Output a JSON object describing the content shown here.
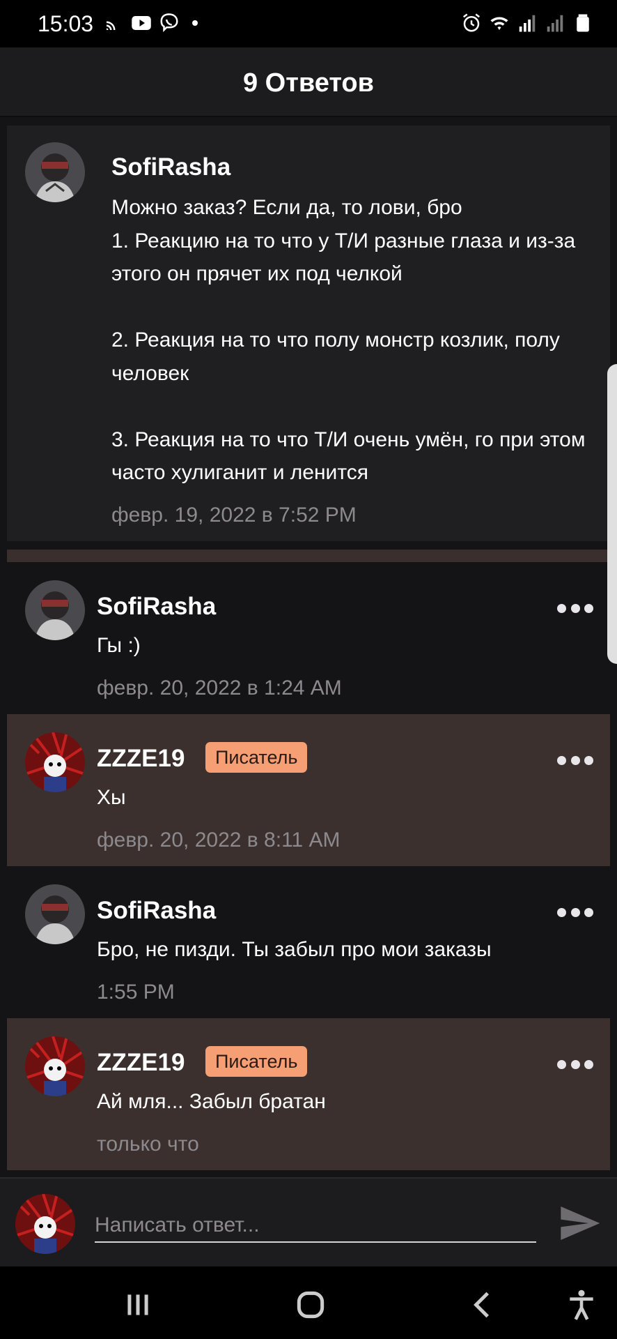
{
  "status_bar": {
    "time": "15:03",
    "left_icons": [
      "cast-icon",
      "youtube-icon",
      "viber-icon",
      "dot-icon"
    ],
    "right_icons": [
      "alarm-icon",
      "wifi-icon",
      "signal-icon",
      "signal-icon",
      "battery-icon"
    ]
  },
  "header": {
    "title": "9 Ответов"
  },
  "parent_comment": {
    "author": "SofiRasha",
    "text": "Можно заказ? Если да, то лови, бро\n1. Реакцию на то что у Т/И разные глаза и из-за этого он прячет их под челкой\n\n2. Реакция на то что полу монстр козлик, полу человек\n\n3. Реакция на то что Т/И очень умён, го при этом часто хулиганит и ленится",
    "time": "февр. 19, 2022 в 7:52 PM"
  },
  "replies": [
    {
      "author": "SofiRasha",
      "badge": "",
      "text": "Гы :)",
      "time": "февр. 20, 2022 в 1:24 AM"
    },
    {
      "author": "ZZZE19",
      "badge": "Писатель",
      "text": "Хы",
      "time": "февр. 20, 2022 в 8:11 AM"
    },
    {
      "author": "SofiRasha",
      "badge": "",
      "text": "Бро, не пизди. Ты забыл про мои заказы",
      "time": "1:55 PM"
    },
    {
      "author": "ZZZE19",
      "badge": "Писатель",
      "text": "Ай мля... Забыл братан",
      "time": "только что"
    }
  ],
  "composer": {
    "placeholder": "Написать ответ..."
  },
  "colors": {
    "background": "#141315",
    "card": "#1f1e21",
    "author_highlight": "#3b302d",
    "badge": "#f79f74",
    "muted_text": "#8c8a8e"
  },
  "nav_bar": {
    "buttons": [
      "recents-icon",
      "home-icon",
      "back-icon",
      "accessibility-icon"
    ]
  }
}
